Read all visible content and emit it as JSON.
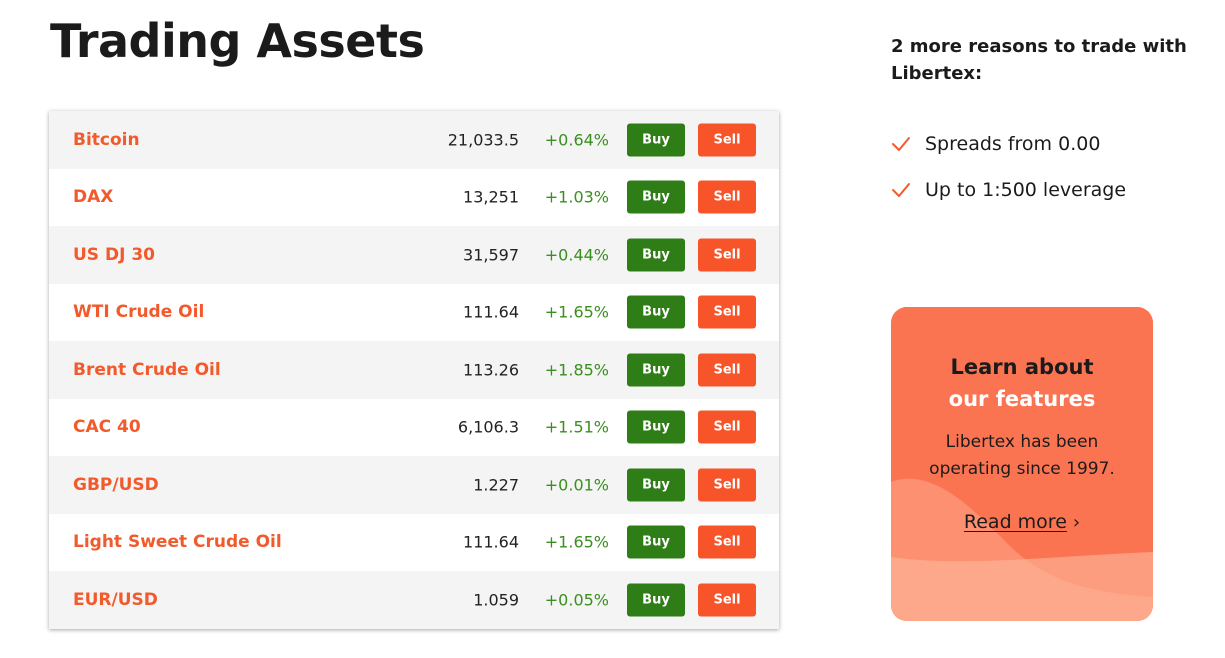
{
  "page": {
    "title": "Trading Assets"
  },
  "assets": [
    {
      "name": "Bitcoin",
      "price": "21,033.5",
      "change": "+0.64%",
      "buy": "Buy",
      "sell": "Sell"
    },
    {
      "name": "DAX",
      "price": "13,251",
      "change": "+1.03%",
      "buy": "Buy",
      "sell": "Sell"
    },
    {
      "name": "US DJ 30",
      "price": "31,597",
      "change": "+0.44%",
      "buy": "Buy",
      "sell": "Sell"
    },
    {
      "name": "WTI Crude Oil",
      "price": "111.64",
      "change": "+1.65%",
      "buy": "Buy",
      "sell": "Sell"
    },
    {
      "name": "Brent Crude Oil",
      "price": "113.26",
      "change": "+1.85%",
      "buy": "Buy",
      "sell": "Sell"
    },
    {
      "name": "CAC 40",
      "price": "6,106.3",
      "change": "+1.51%",
      "buy": "Buy",
      "sell": "Sell"
    },
    {
      "name": "GBP/USD",
      "price": "1.227",
      "change": "+0.01%",
      "buy": "Buy",
      "sell": "Sell"
    },
    {
      "name": "Light Sweet Crude Oil",
      "price": "111.64",
      "change": "+1.65%",
      "buy": "Buy",
      "sell": "Sell"
    },
    {
      "name": "EUR/USD",
      "price": "1.059",
      "change": "+0.05%",
      "buy": "Buy",
      "sell": "Sell"
    }
  ],
  "reasons": {
    "title": "2 more reasons to trade with Libertex:",
    "items": [
      "Spreads from 0.00",
      "Up to 1:500 leverage"
    ],
    "icon": "check-icon"
  },
  "promo": {
    "heading_line1": "Learn about",
    "heading_line2": "our features",
    "text": "Libertex has been operating since 1997.",
    "link_label": "Read more",
    "link_arrow": "›"
  },
  "colors": {
    "accent": "#f25a2c",
    "buy": "#2e7d16",
    "sell": "#f7542a",
    "positive_change": "#3a8f1e",
    "promo_bg": "#fb7452"
  }
}
